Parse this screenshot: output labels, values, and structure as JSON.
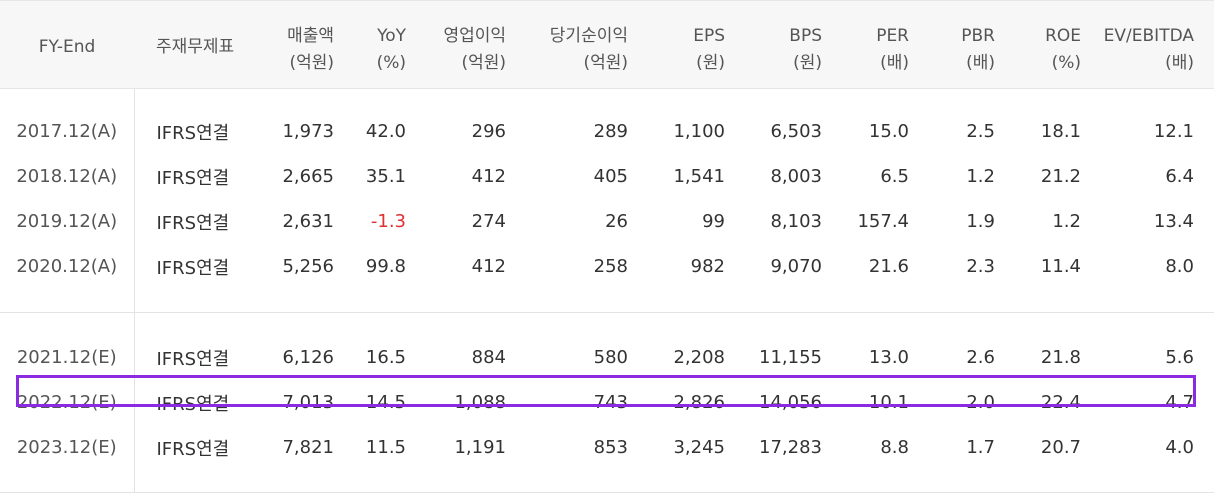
{
  "table": {
    "headers": [
      {
        "label": "FY-End",
        "unit": ""
      },
      {
        "label": "주재무제표",
        "unit": ""
      },
      {
        "label": "매출액",
        "unit": "(억원)"
      },
      {
        "label": "YoY",
        "unit": "(%)"
      },
      {
        "label": "영업이익",
        "unit": "(억원)"
      },
      {
        "label": "당기순이익",
        "unit": "(억원)"
      },
      {
        "label": "EPS",
        "unit": "(원)"
      },
      {
        "label": "BPS",
        "unit": "(원)"
      },
      {
        "label": "PER",
        "unit": "(배)"
      },
      {
        "label": "PBR",
        "unit": "(배)"
      },
      {
        "label": "ROE",
        "unit": "(%)"
      },
      {
        "label": "EV/EBITDA",
        "unit": "(배)"
      }
    ],
    "actual_rows": [
      [
        "2017.12(A)",
        "IFRS연결",
        "1,973",
        "42.0",
        "296",
        "289",
        "1,100",
        "6,503",
        "15.0",
        "2.5",
        "18.1",
        "12.1"
      ],
      [
        "2018.12(A)",
        "IFRS연결",
        "2,665",
        "35.1",
        "412",
        "405",
        "1,541",
        "8,003",
        "6.5",
        "1.2",
        "21.2",
        "6.4"
      ],
      [
        "2019.12(A)",
        "IFRS연결",
        "2,631",
        "-1.3",
        "274",
        "26",
        "99",
        "8,103",
        "157.4",
        "1.9",
        "1.2",
        "13.4"
      ],
      [
        "2020.12(A)",
        "IFRS연결",
        "5,256",
        "99.8",
        "412",
        "258",
        "982",
        "9,070",
        "21.6",
        "2.3",
        "11.4",
        "8.0"
      ]
    ],
    "estimate_rows": [
      [
        "2021.12(E)",
        "IFRS연결",
        "6,126",
        "16.5",
        "884",
        "580",
        "2,208",
        "11,155",
        "13.0",
        "2.6",
        "21.8",
        "5.6"
      ],
      [
        "2022.12(E)",
        "IFRS연결",
        "7,013",
        "14.5",
        "1,088",
        "743",
        "2,826",
        "14,056",
        "10.1",
        "2.0",
        "22.4",
        "4.7"
      ],
      [
        "2023.12(E)",
        "IFRS연결",
        "7,821",
        "11.5",
        "1,191",
        "853",
        "3,245",
        "17,283",
        "8.8",
        "1.7",
        "20.7",
        "4.0"
      ]
    ],
    "highlighted_row": "2022.12(E)",
    "colors": {
      "negative": "#e0302f",
      "highlight_border": "#8a2be2",
      "header_bg": "#f7f7f7"
    }
  }
}
